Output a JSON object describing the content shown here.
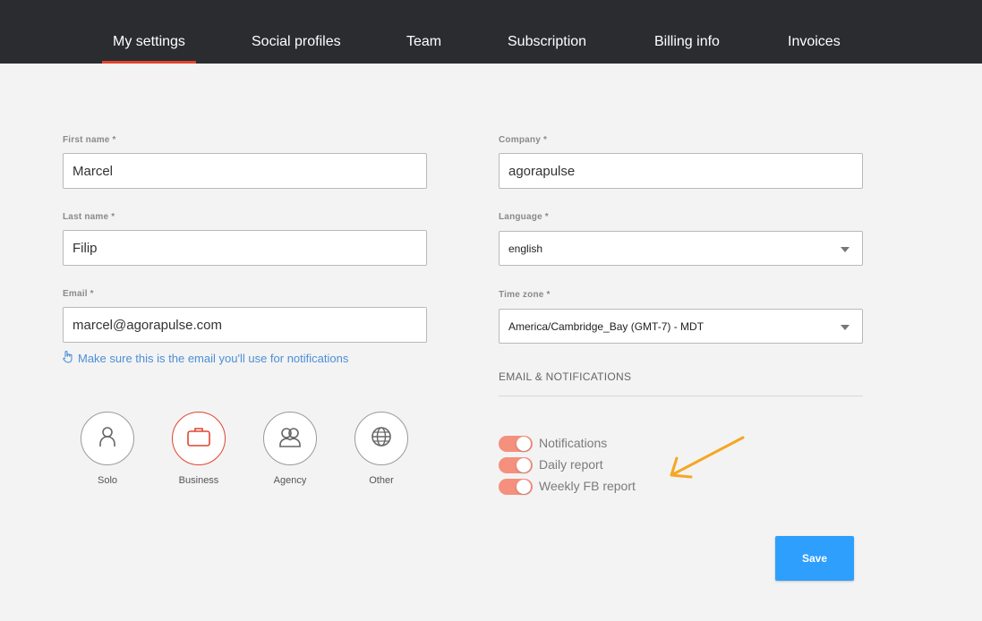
{
  "nav": {
    "tabs": [
      {
        "label": "My settings",
        "active": true
      },
      {
        "label": "Social profiles"
      },
      {
        "label": "Team"
      },
      {
        "label": "Subscription"
      },
      {
        "label": "Billing info"
      },
      {
        "label": "Invoices"
      }
    ]
  },
  "form": {
    "first_name": {
      "label": "First name *",
      "value": "Marcel"
    },
    "last_name": {
      "label": "Last name *",
      "value": "Filip"
    },
    "email": {
      "label": "Email *",
      "value": "marcel@agorapulse.com",
      "hint": "Make sure this is the email you'll use for notifications"
    },
    "company": {
      "label": "Company *",
      "value": "agorapulse"
    },
    "language": {
      "label": "Language *",
      "value": "english"
    },
    "timezone": {
      "label": "Time zone *",
      "value": "America/Cambridge_Bay (GMT-7) - MDT"
    }
  },
  "roles": [
    {
      "label": "Solo",
      "icon": "person-icon"
    },
    {
      "label": "Business",
      "icon": "briefcase-icon",
      "selected": true
    },
    {
      "label": "Agency",
      "icon": "group-icon"
    },
    {
      "label": "Other",
      "icon": "globe-icon"
    }
  ],
  "notifications": {
    "title": "EMAIL & NOTIFICATIONS",
    "items": [
      {
        "label": "Notifications",
        "on": true
      },
      {
        "label": "Daily report",
        "on": true
      },
      {
        "label": "Weekly FB report",
        "on": true
      }
    ]
  },
  "save_label": "Save",
  "colors": {
    "accent": "#e0452f",
    "toggle_on": "#f4907d",
    "save": "#2e9ffd",
    "nav_bg": "#2a2c30",
    "hint": "#4b8fd6",
    "arrow": "#f5a623"
  }
}
